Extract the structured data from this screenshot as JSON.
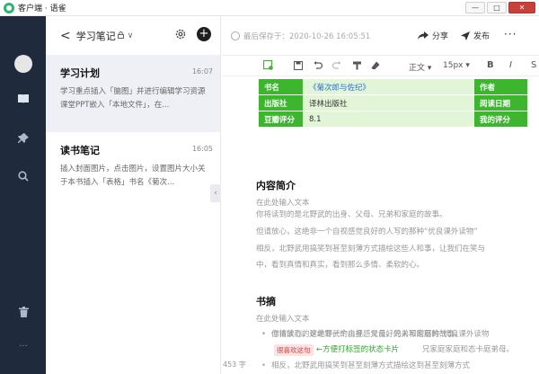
{
  "window": {
    "title": "客户端 · 语雀",
    "controls": {
      "minimize": "—",
      "maximize": "□",
      "close": "✕"
    }
  },
  "sidebar": {
    "icons": [
      "book-icon",
      "pin-icon",
      "search-icon",
      "trash-icon",
      "more-icon"
    ],
    "more_label": "···"
  },
  "notelist": {
    "back": "<",
    "title": "学习笔记",
    "lock": "🔒",
    "caret": "∨",
    "add": "+",
    "notes": [
      {
        "title": "学习计划",
        "time": "16:07",
        "snippet": "学习重点插入「脑图」并进行编辑学习资源课堂PPT嵌入「本地文件」，在..."
      },
      {
        "title": "读书笔记",
        "time": "16:05",
        "snippet": "插入封面图片，点击图片，设置图片大小关于本书插入「表格」书名《菊次..."
      }
    ],
    "collapse": "‹"
  },
  "editor": {
    "saved_at": "最后保存于：2020-10-26 16:05:51",
    "share": "分享",
    "publish": "发布",
    "more": "···",
    "toolbar": {
      "style": "正文",
      "size": "15px",
      "bold": "B",
      "italic": "I",
      "strike": "S"
    },
    "table": {
      "rows": [
        {
          "label": "书名",
          "value": "《菊次郎与佐纪》",
          "label2": "作者",
          "link": true
        },
        {
          "label": "出版社",
          "value": "译林出版社",
          "label2": "阅读日期",
          "link": false
        },
        {
          "label": "豆瓣评分",
          "value": "8.1",
          "label2": "我的评分",
          "link": false
        }
      ]
    },
    "intro": {
      "title": "内容简介",
      "hint": "在此处输入文本",
      "lines": [
        "你将读到的是北野武的出身、父母、兄弟和家庭的故事。",
        "但请放心，这绝非一个自视感觉良好的人写的那种“优良课外读物”",
        "相反，北野武用搞笑到甚至刻薄方式描绘这些人和事，让我们在笑与",
        "中，看到真情和真实，看到那么多情、柔软的心。"
      ]
    },
    "excerpt": {
      "title": "书摘",
      "hint": "在此处输入文本",
      "bullets": [
        "你将读到的是北野武的出身、父母、兄弟和家庭的故事。",
        "但请放心，这绝非一个自视感觉良好的人写的那种“优良课外读物",
        "相反，北野武用搞笑到甚至刻薄方式描绘这到甚至刻薄方式"
      ],
      "tag": "很喜欢这句",
      "annotation": "←方便打标签的状态卡片",
      "annotation_tail": "兄家庭家庭和态卡庭弟母。"
    },
    "word_count": "453 字"
  },
  "colors": {
    "sidebar_bg": "#1f2a3d",
    "accent_green": "#3db52f",
    "table_value_bg": "#e2f5d7"
  }
}
